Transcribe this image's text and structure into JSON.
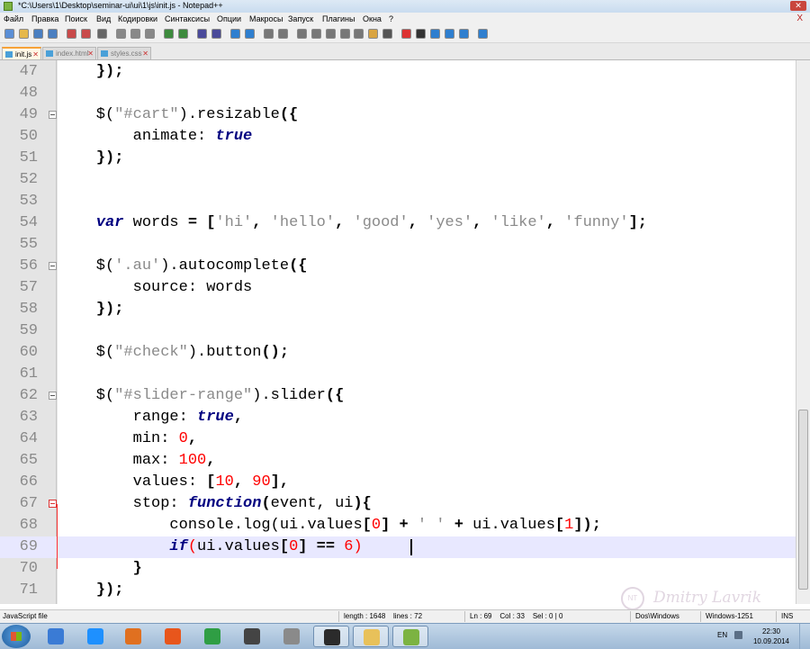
{
  "window": {
    "title": "*C:\\Users\\1\\Desktop\\seminar-ui\\ui\\1\\js\\init.js - Notepad++",
    "close_icon": "close-icon"
  },
  "menu": [
    "Файл",
    "Правка",
    "Поиск",
    "Вид",
    "Кодировки",
    "Синтаксисы",
    "Опции",
    "Макросы",
    "Запуск",
    "Плагины",
    "Окна",
    "?"
  ],
  "menu_close": "X",
  "toolbar": {
    "icons": [
      "new-file-icon",
      "open-icon",
      "save-icon",
      "save-all-icon",
      "close-file-icon",
      "close-all-icon",
      "print-icon",
      "cut-icon",
      "copy-icon",
      "paste-icon",
      "undo-icon",
      "redo-icon",
      "find-icon",
      "replace-icon",
      "zoom-in-icon",
      "zoom-out-icon",
      "sync-vertical-icon",
      "sync-horizontal-icon",
      "word-wrap-icon",
      "show-all-chars-icon",
      "indent-guide-icon",
      "doc-map-icon",
      "function-list-icon",
      "folder-icon",
      "monitor-icon",
      "record-macro-icon",
      "stop-macro-icon",
      "play-macro-icon",
      "run-macro-icon",
      "save-macro-icon",
      "spellcheck-icon"
    ]
  },
  "tabs": [
    {
      "label": "init.js",
      "active": true
    },
    {
      "label": "index.html",
      "active": false
    },
    {
      "label": "styles.css",
      "active": false
    }
  ],
  "editor": {
    "lines": [
      {
        "n": "47",
        "fold": "",
        "tokens": [
          [
            "p",
            "    "
          ],
          [
            "op",
            "});"
          ]
        ]
      },
      {
        "n": "48",
        "fold": "",
        "tokens": []
      },
      {
        "n": "49",
        "fold": "box",
        "tokens": [
          [
            "p",
            "    $("
          ],
          [
            "str",
            "\"#cart\""
          ],
          [
            "p",
            ").resizable"
          ],
          [
            "op",
            "({"
          ]
        ]
      },
      {
        "n": "50",
        "fold": "",
        "tokens": [
          [
            "p",
            "        animate: "
          ],
          [
            "kw",
            "true"
          ]
        ]
      },
      {
        "n": "51",
        "fold": "",
        "tokens": [
          [
            "p",
            "    "
          ],
          [
            "op",
            "});"
          ]
        ]
      },
      {
        "n": "52",
        "fold": "",
        "tokens": []
      },
      {
        "n": "53",
        "fold": "",
        "tokens": []
      },
      {
        "n": "54",
        "fold": "",
        "tokens": [
          [
            "p",
            "    "
          ],
          [
            "kw",
            "var"
          ],
          [
            "p",
            " words "
          ],
          [
            "op",
            "="
          ],
          [
            "p",
            " "
          ],
          [
            "op",
            "["
          ],
          [
            "str",
            "'hi'"
          ],
          [
            "op",
            ","
          ],
          [
            "p",
            " "
          ],
          [
            "str",
            "'hello'"
          ],
          [
            "op",
            ","
          ],
          [
            "p",
            " "
          ],
          [
            "str",
            "'good'"
          ],
          [
            "op",
            ","
          ],
          [
            "p",
            " "
          ],
          [
            "str",
            "'yes'"
          ],
          [
            "op",
            ","
          ],
          [
            "p",
            " "
          ],
          [
            "str",
            "'like'"
          ],
          [
            "op",
            ","
          ],
          [
            "p",
            " "
          ],
          [
            "str",
            "'funny'"
          ],
          [
            "op",
            "];"
          ]
        ]
      },
      {
        "n": "55",
        "fold": "",
        "tokens": []
      },
      {
        "n": "56",
        "fold": "box",
        "tokens": [
          [
            "p",
            "    $("
          ],
          [
            "str",
            "'.au'"
          ],
          [
            "p",
            ").autocomplete"
          ],
          [
            "op",
            "({"
          ]
        ]
      },
      {
        "n": "57",
        "fold": "",
        "tokens": [
          [
            "p",
            "        source: words"
          ]
        ]
      },
      {
        "n": "58",
        "fold": "",
        "tokens": [
          [
            "p",
            "    "
          ],
          [
            "op",
            "});"
          ]
        ]
      },
      {
        "n": "59",
        "fold": "",
        "tokens": []
      },
      {
        "n": "60",
        "fold": "",
        "tokens": [
          [
            "p",
            "    $("
          ],
          [
            "str",
            "\"#check\""
          ],
          [
            "p",
            ").button"
          ],
          [
            "op",
            "();"
          ]
        ]
      },
      {
        "n": "61",
        "fold": "",
        "tokens": []
      },
      {
        "n": "62",
        "fold": "box",
        "tokens": [
          [
            "p",
            "    $("
          ],
          [
            "str",
            "\"#slider-range\""
          ],
          [
            "p",
            ").slider"
          ],
          [
            "op",
            "({"
          ]
        ]
      },
      {
        "n": "63",
        "fold": "",
        "tokens": [
          [
            "p",
            "        range: "
          ],
          [
            "kw",
            "true"
          ],
          [
            "op",
            ","
          ]
        ]
      },
      {
        "n": "64",
        "fold": "",
        "tokens": [
          [
            "p",
            "        min: "
          ],
          [
            "num",
            "0"
          ],
          [
            "op",
            ","
          ]
        ]
      },
      {
        "n": "65",
        "fold": "",
        "tokens": [
          [
            "p",
            "        max: "
          ],
          [
            "num",
            "100"
          ],
          [
            "op",
            ","
          ]
        ]
      },
      {
        "n": "66",
        "fold": "",
        "tokens": [
          [
            "p",
            "        values: "
          ],
          [
            "op",
            "["
          ],
          [
            "num",
            "10"
          ],
          [
            "op",
            ","
          ],
          [
            "p",
            " "
          ],
          [
            "num",
            "90"
          ],
          [
            "op",
            "],"
          ]
        ]
      },
      {
        "n": "67",
        "fold": "red",
        "tokens": [
          [
            "p",
            "        stop: "
          ],
          [
            "kw",
            "function"
          ],
          [
            "op",
            "("
          ],
          [
            "p",
            "event, ui"
          ],
          [
            "op",
            "){"
          ]
        ]
      },
      {
        "n": "68",
        "fold": "",
        "tokens": [
          [
            "p",
            "            console.log(ui.values"
          ],
          [
            "op",
            "["
          ],
          [
            "num",
            "0"
          ],
          [
            "op",
            "]"
          ],
          [
            "p",
            " "
          ],
          [
            "op",
            "+"
          ],
          [
            "p",
            " "
          ],
          [
            "str",
            "' '"
          ],
          [
            "p",
            " "
          ],
          [
            "op",
            "+"
          ],
          [
            "p",
            " ui.values"
          ],
          [
            "op",
            "["
          ],
          [
            "num",
            "1"
          ],
          [
            "op",
            "]);"
          ]
        ]
      },
      {
        "n": "69",
        "fold": "",
        "current": true,
        "tokens": [
          [
            "p",
            "            "
          ],
          [
            "kw",
            "if"
          ],
          [
            "num",
            "("
          ],
          [
            "p",
            "ui.values"
          ],
          [
            "op",
            "["
          ],
          [
            "num",
            "0"
          ],
          [
            "op",
            "]"
          ],
          [
            "p",
            " "
          ],
          [
            "op",
            "=="
          ],
          [
            "p",
            " "
          ],
          [
            "num",
            "6"
          ],
          [
            "num",
            ")"
          ]
        ]
      },
      {
        "n": "70",
        "fold": "",
        "tokens": [
          [
            "p",
            "        "
          ],
          [
            "op",
            "}"
          ]
        ]
      },
      {
        "n": "71",
        "fold": "",
        "tokens": [
          [
            "p",
            "    "
          ],
          [
            "op",
            "});"
          ]
        ]
      }
    ]
  },
  "watermark": {
    "seal_text": "NT",
    "signature": "Dmitry Lavrik"
  },
  "status": {
    "file_type": "JavaScript file",
    "length": "length : 1648",
    "lines": "lines : 72",
    "position": "Ln : 69    Col : 33    Sel : 0 | 0",
    "eol": "Dos\\Windows",
    "encoding": "Windows-1251",
    "mode": "INS"
  },
  "taskbar": {
    "apps": [
      "explorer-icon",
      "ie-icon",
      "media-player-icon",
      "firefox-icon",
      "chrome-icon",
      "app-icon",
      "tool-icon",
      "media-icon",
      "folder-icon",
      "notepadpp-icon"
    ],
    "app_colors": [
      "#3a7bd5",
      "#1e90ff",
      "#e07020",
      "#e8561c",
      "#2f9e44",
      "#444444",
      "#8a8a8a",
      "#2b2b2b",
      "#e8c15a",
      "#7cb342"
    ],
    "lang": "EN",
    "time": "22:30",
    "date": "10.09.2014"
  }
}
